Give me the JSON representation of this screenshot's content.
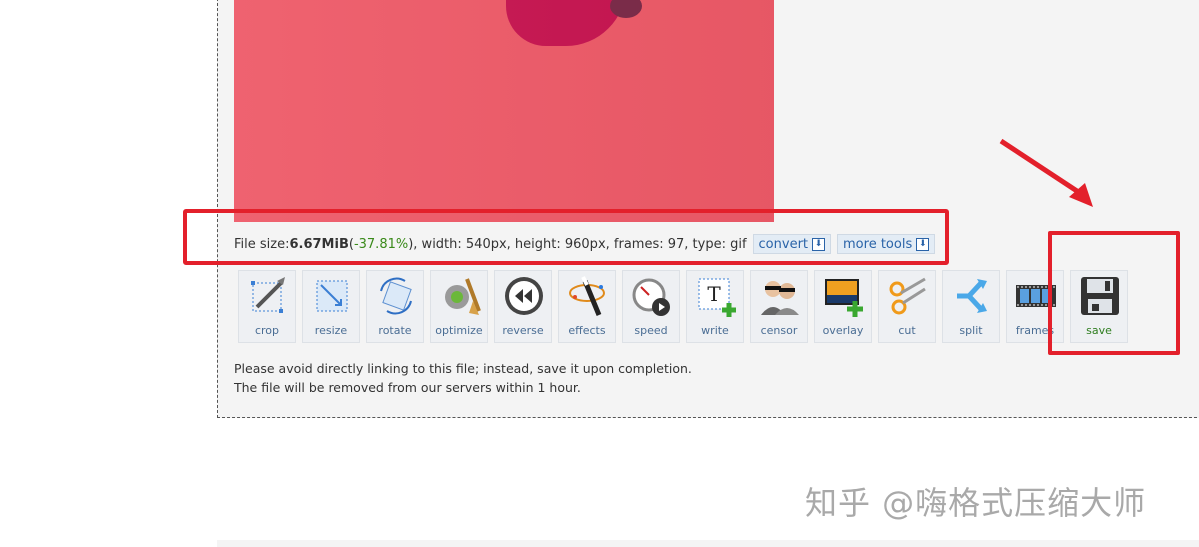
{
  "file_info": {
    "prefix": "File size: ",
    "size": "6.67MiB",
    "open_paren": " (",
    "percent": "-37.81%",
    "rest": "), width: 540px, height: 960px, frames: 97, type: gif"
  },
  "buttons": {
    "convert": "convert",
    "more_tools": "more tools"
  },
  "tools": [
    {
      "label": "crop",
      "icon": "crop-icon"
    },
    {
      "label": "resize",
      "icon": "resize-icon"
    },
    {
      "label": "rotate",
      "icon": "rotate-icon"
    },
    {
      "label": "optimize",
      "icon": "optimize-icon"
    },
    {
      "label": "reverse",
      "icon": "reverse-icon"
    },
    {
      "label": "effects",
      "icon": "effects-icon"
    },
    {
      "label": "speed",
      "icon": "speed-icon"
    },
    {
      "label": "write",
      "icon": "write-icon"
    },
    {
      "label": "censor",
      "icon": "censor-icon"
    },
    {
      "label": "overlay",
      "icon": "overlay-icon"
    },
    {
      "label": "cut",
      "icon": "cut-icon"
    },
    {
      "label": "split",
      "icon": "split-icon"
    },
    {
      "label": "frames",
      "icon": "frames-icon"
    },
    {
      "label": "save",
      "icon": "save-icon"
    }
  ],
  "notes": {
    "line1": "Please avoid directly linking to this file; instead, save it upon completion.",
    "line2": "The file will be removed from our servers within 1 hour."
  },
  "watermark": "知乎 @嗨格式压缩大师",
  "colors": {
    "accent_red": "#e3202b",
    "preview_pink": "#ee5a68",
    "percent_green": "#3a8a1a",
    "tool_label_blue": "#4a6d94",
    "save_label_green": "#2e7d1f"
  }
}
